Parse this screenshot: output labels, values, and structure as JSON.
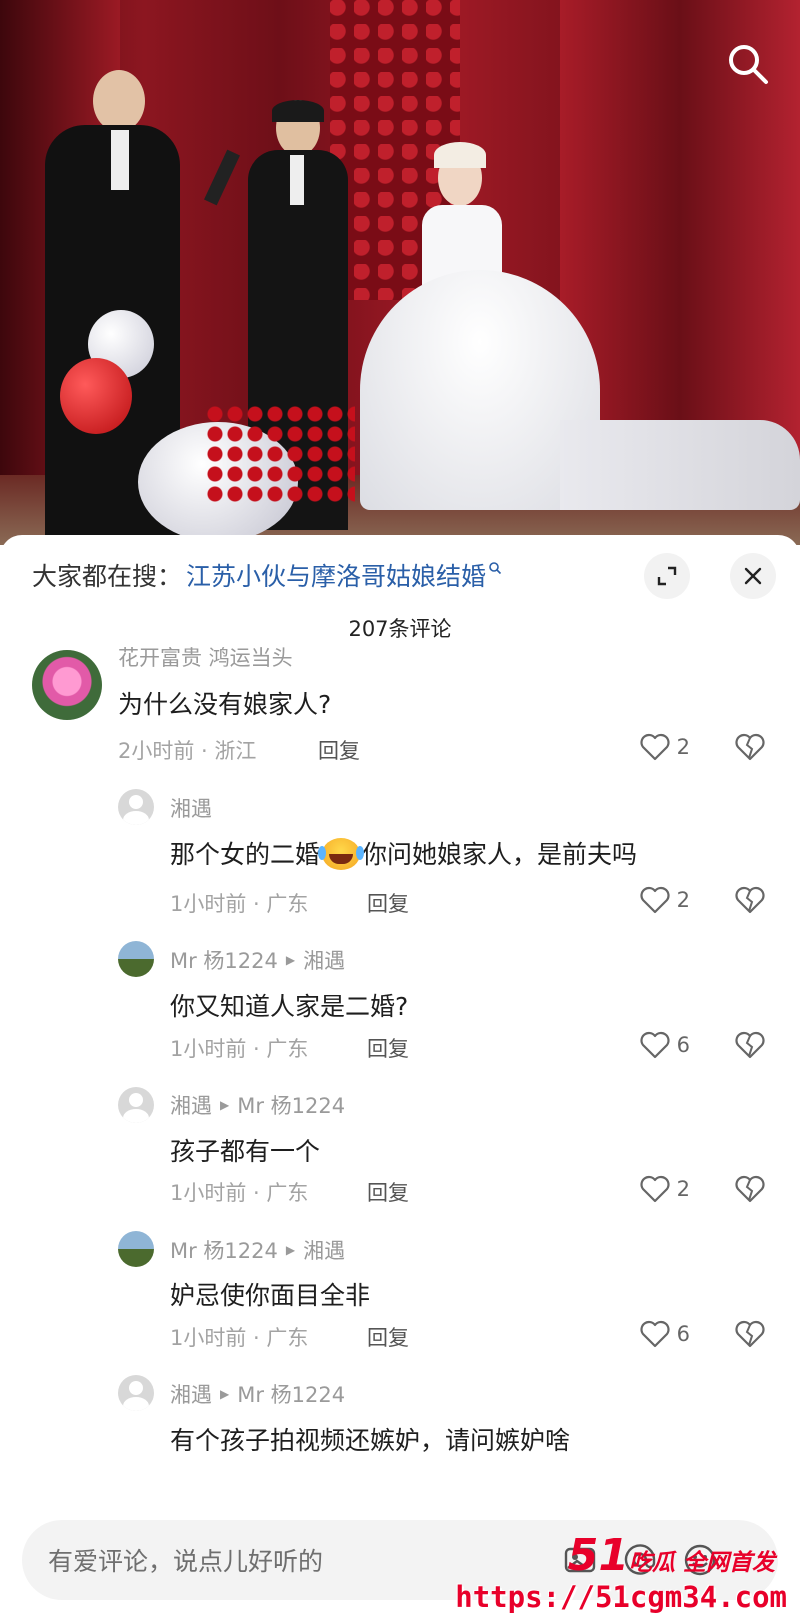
{
  "trending": {
    "prefix": "大家都在搜：",
    "query": "江苏小伙与摩洛哥姑娘结婚"
  },
  "comment_count": "207条评论",
  "comments": [
    {
      "user": "花开富贵 鸿运当头",
      "reply_to": "",
      "text": "为什么没有娘家人?",
      "time": "2小时前",
      "location": "浙江",
      "reply": "回复",
      "likes": "2"
    },
    {
      "user": "湘遇",
      "reply_to": "",
      "text_before": "那个女的二婚",
      "emoji": "crying-laughing-emoji",
      "text_after": "你问她娘家人，是前夫吗",
      "time": "1小时前",
      "location": "广东",
      "reply": "回复",
      "likes": "2"
    },
    {
      "user": "Mr 杨1224",
      "reply_to": "湘遇",
      "text": "你又知道人家是二婚?",
      "time": "1小时前",
      "location": "广东",
      "reply": "回复",
      "likes": "6"
    },
    {
      "user": "湘遇",
      "reply_to": "Mr 杨1224",
      "text": "孩子都有一个",
      "time": "1小时前",
      "location": "广东",
      "reply": "回复",
      "likes": "2"
    },
    {
      "user": "Mr 杨1224",
      "reply_to": "湘遇",
      "text": "妒忌使你面目全非",
      "time": "1小时前",
      "location": "广东",
      "reply": "回复",
      "likes": "6"
    },
    {
      "user": "湘遇",
      "reply_to": "Mr 杨1224",
      "text": "有个孩子拍视频还嫉妒，请问嫉妒啥"
    }
  ],
  "input": {
    "placeholder": "有爱评论，说点儿好听的"
  },
  "watermark": {
    "line1_big": "51",
    "line1_small": "吃瓜 全网首发",
    "line2": "https://51cgm34.com"
  },
  "icons": {
    "search": "search-icon",
    "expand": "expand-icon",
    "close": "close-icon",
    "like": "heart-icon",
    "dislike": "broken-heart-icon",
    "image": "image-icon",
    "mention": "at-icon",
    "emoji": "emoji-icon"
  },
  "colors": {
    "link": "#2a5fa8",
    "watermark": "#e8002a"
  }
}
